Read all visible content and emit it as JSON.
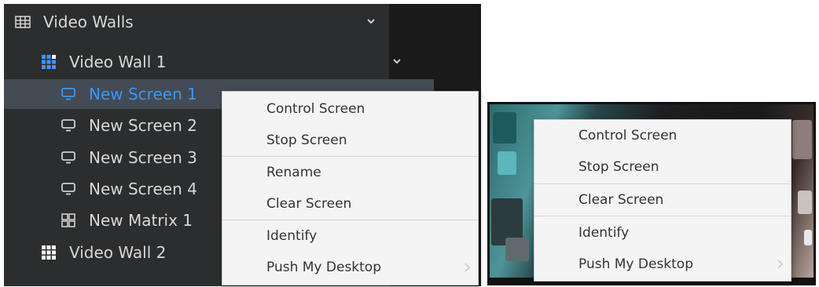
{
  "tree": {
    "root": {
      "label": "Video Walls",
      "icon": "video-walls-icon"
    },
    "walls": [
      {
        "label": "Video Wall 1",
        "icon": "grid-icon"
      },
      {
        "label": "Video Wall 2",
        "icon": "grid-icon"
      }
    ],
    "screens": [
      {
        "label": "New Screen 1",
        "icon": "screen-icon",
        "selected": true
      },
      {
        "label": "New Screen 2",
        "icon": "screen-icon"
      },
      {
        "label": "New Screen 3",
        "icon": "screen-icon"
      },
      {
        "label": "New Screen 4",
        "icon": "screen-icon"
      },
      {
        "label": "New Matrix 1",
        "icon": "matrix-icon"
      }
    ]
  },
  "context_menu_left": {
    "items": [
      "Control Screen",
      "Stop Screen",
      "Rename",
      "Clear Screen",
      "Identify",
      "Push My Desktop"
    ]
  },
  "context_menu_right": {
    "items": [
      "Control Screen",
      "Stop Screen",
      "Clear Screen",
      "Identify",
      "Push My Desktop"
    ]
  },
  "colors": {
    "panel_bg": "#2c2d2e",
    "selected_bg": "#434b54",
    "accent": "#3d96f4",
    "menu_bg": "#f4f4f4"
  }
}
